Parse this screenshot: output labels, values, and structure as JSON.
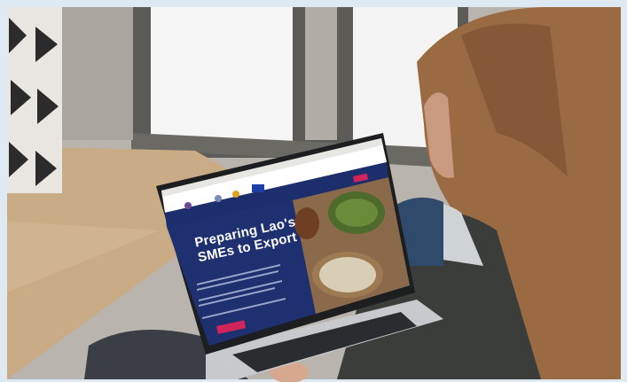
{
  "photo": {
    "description_label": "",
    "colors": {
      "background_frame": "#dfe9f2",
      "window_glass": "#f5f6f6",
      "wall": "#b7b4ae",
      "floor_wood": "#c9ab86",
      "laptop_silver": "#c7c8cb",
      "laptop_keyboard": "#2b2c2f",
      "site_navy": "#1c2e6b",
      "site_header": "#ffffff",
      "accent_pink": "#d1255a",
      "hair": "#9a6a43",
      "sweater": "#3a3d3a",
      "jeans": "#3b3f45"
    }
  },
  "website": {
    "hero_title": "Preparing Lao's SMEs to Export",
    "cta_label": "",
    "nav_items": [
      "",
      "",
      "",
      ""
    ],
    "nav_button_label": ""
  }
}
